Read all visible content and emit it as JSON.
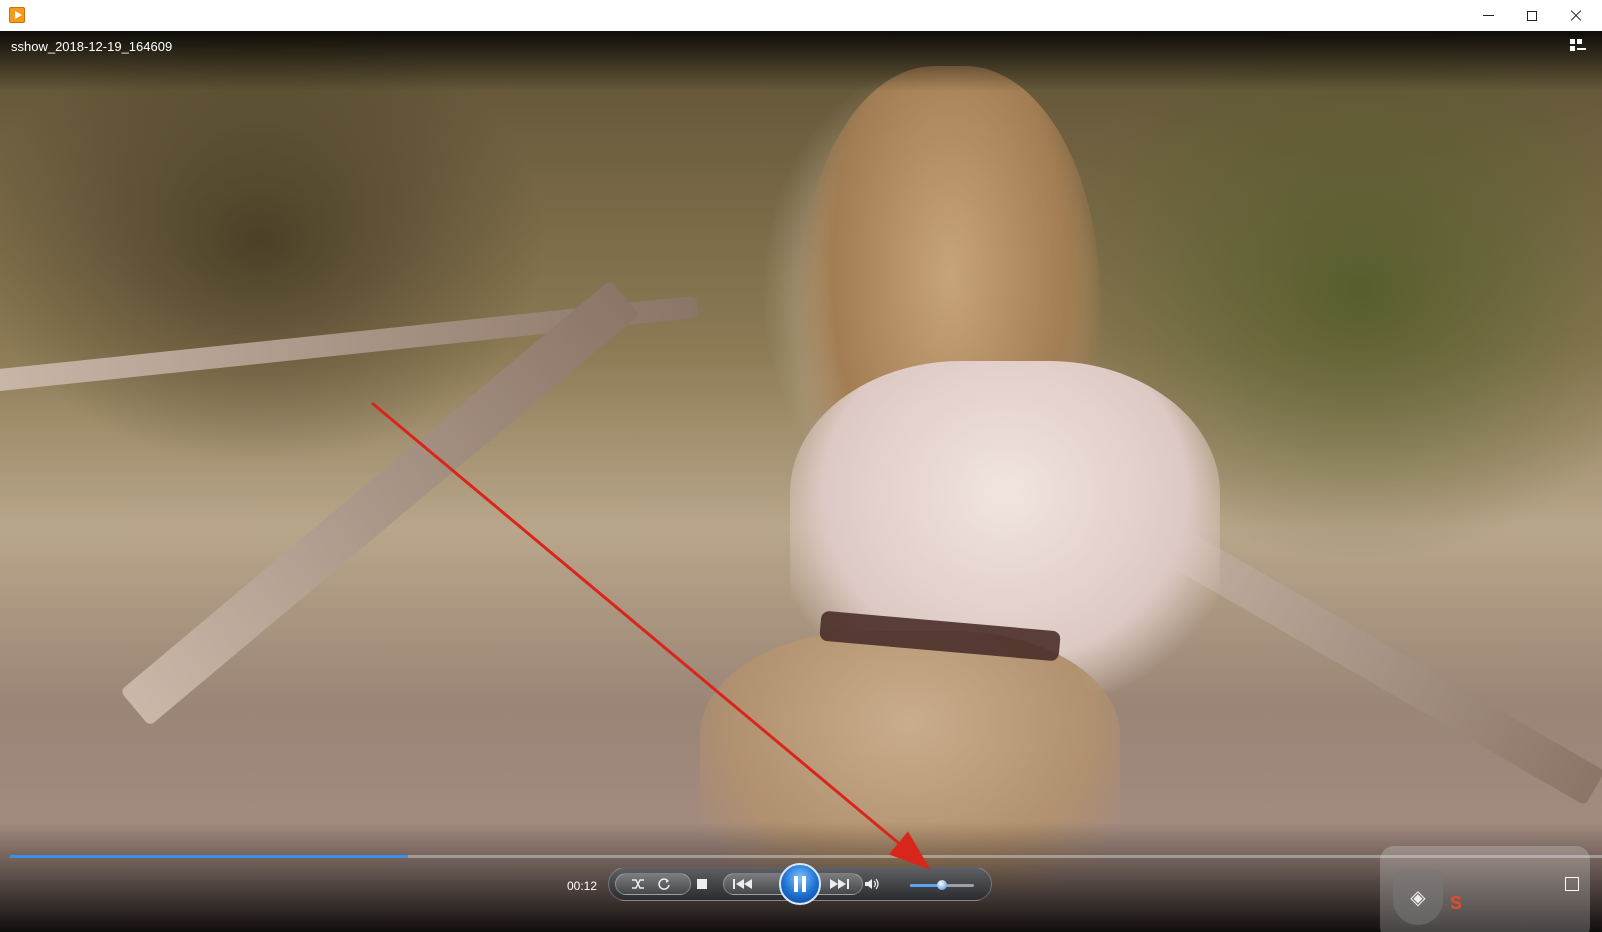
{
  "window": {
    "title": "",
    "buttons": {
      "minimize": "minimize",
      "maximize": "maximize",
      "close": "close"
    }
  },
  "video": {
    "title": "sshow_2018-12-19_164609",
    "progress_fraction": 0.25
  },
  "controls": {
    "time": "00:12",
    "volume_fraction": 0.5,
    "buttons": [
      "shuffle-icon",
      "repeat-icon",
      "stop-icon",
      "previous-icon",
      "pause-icon",
      "next-icon",
      "volume-icon"
    ]
  },
  "annotation": {
    "arrow_color": "#d9261c"
  },
  "colors": {
    "accent": "#3c8fe6",
    "play_button": "#1c6fd1"
  }
}
